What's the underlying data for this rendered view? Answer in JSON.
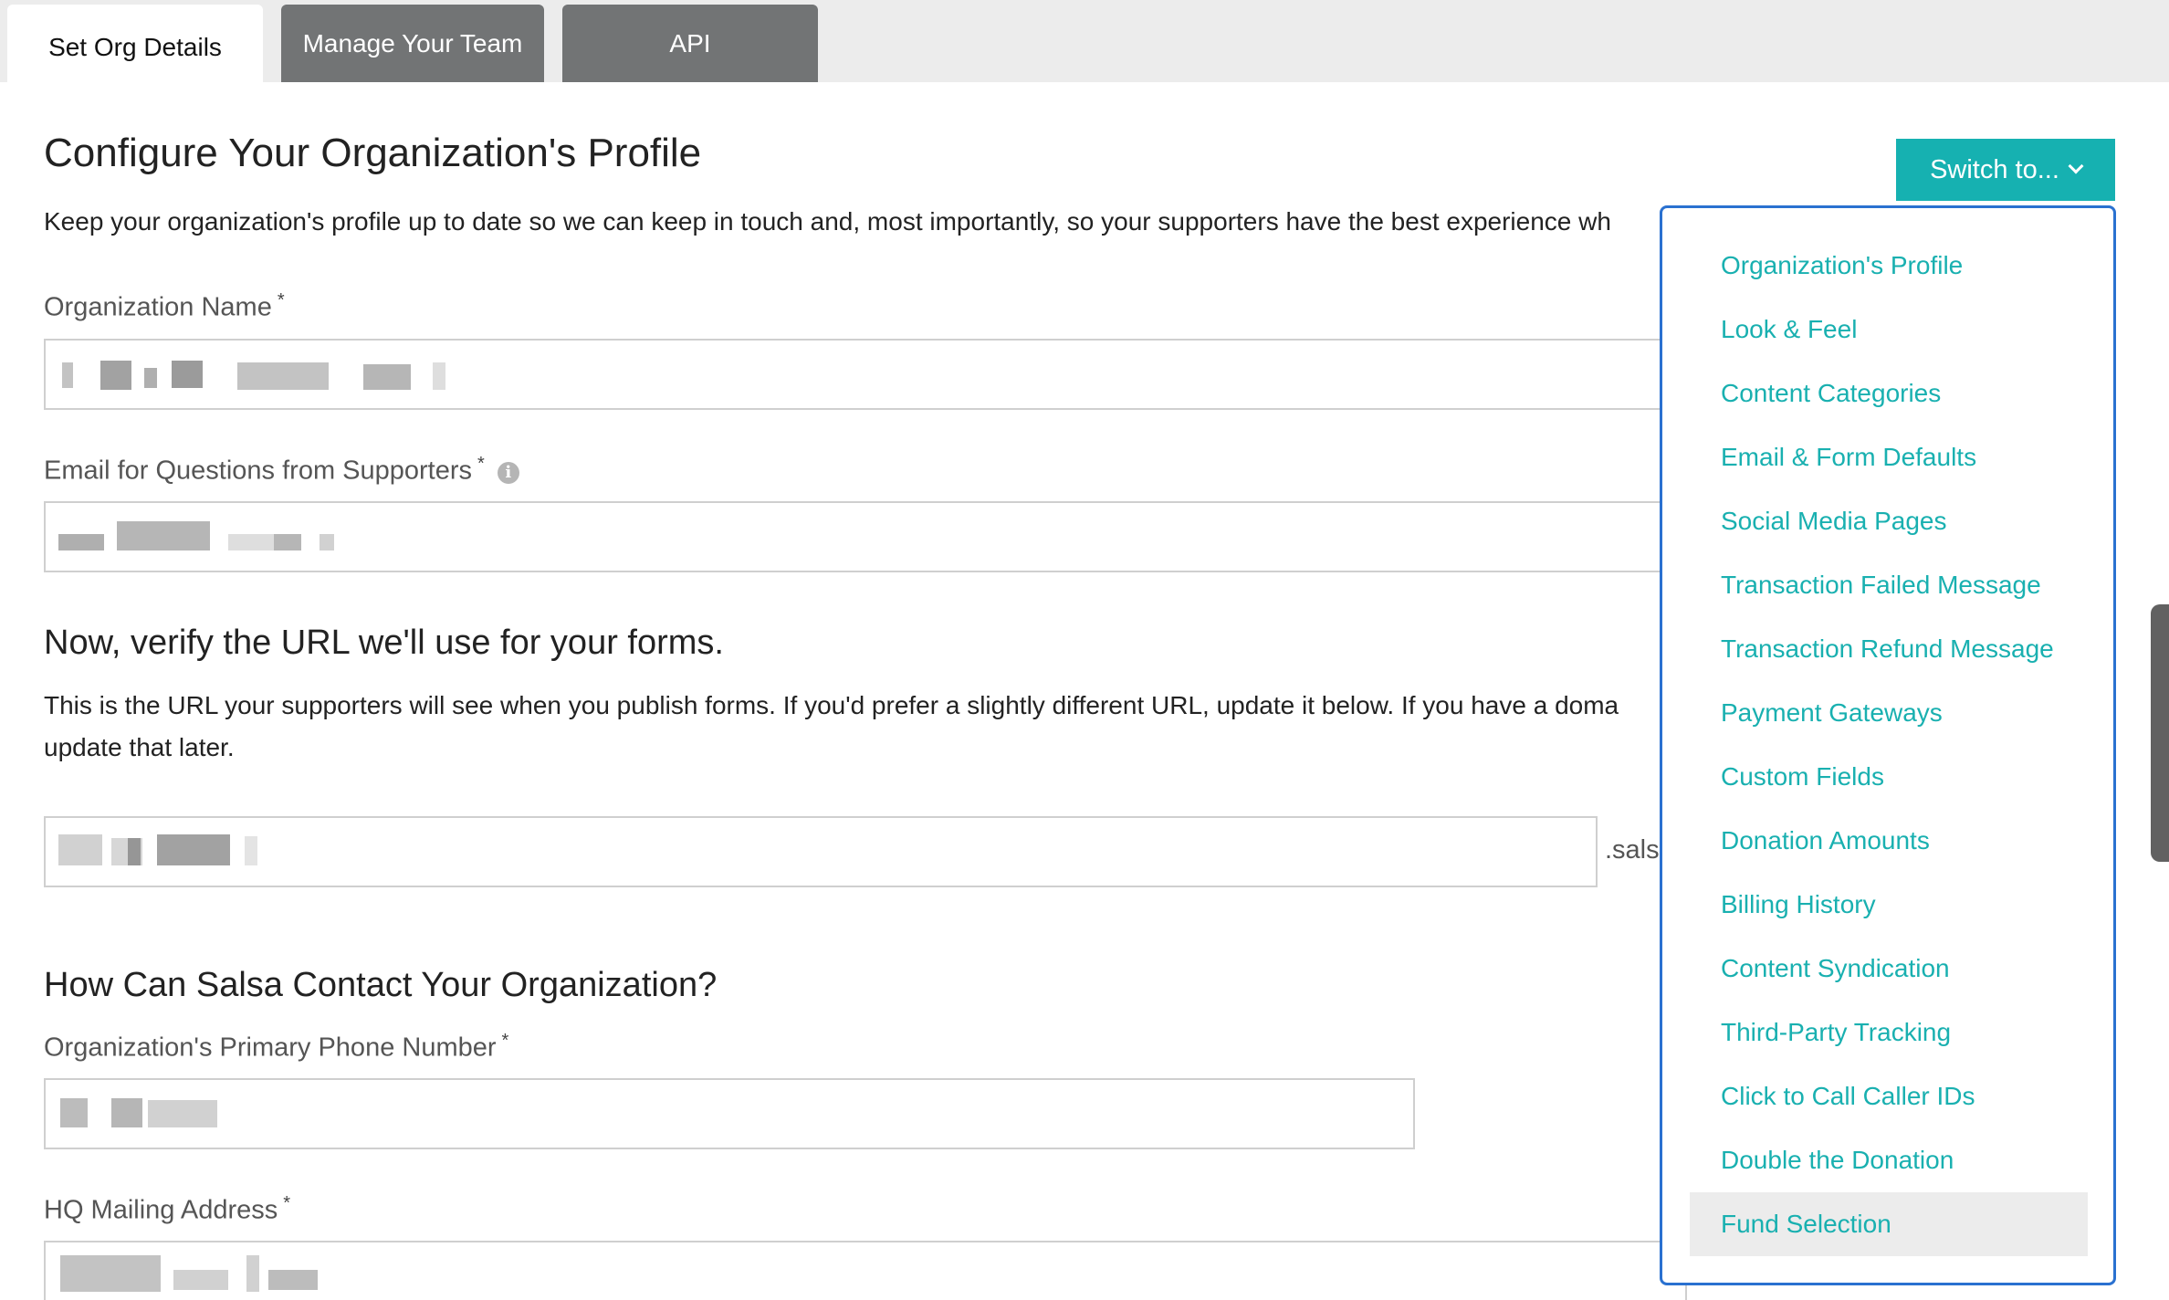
{
  "tabs": [
    {
      "label": "Set Org Details"
    },
    {
      "label": "Manage Your Team"
    },
    {
      "label": "API"
    }
  ],
  "profile": {
    "title": "Configure Your Organization's Profile",
    "description": "Keep your organization's profile up to date so we can keep in touch and, most importantly, so your supporters have the best experience wh"
  },
  "fields": {
    "org_name_label": "Organization Name",
    "email_label": "Email for Questions from Supporters",
    "required_mark": "*",
    "info_glyph": "i"
  },
  "url_section": {
    "title": "Now, verify the URL we'll use for your forms.",
    "line1": "This is the URL your supporters will see when you publish forms. If you'd prefer a slightly different URL, update it below. If you have a doma",
    "line2": "update that later.",
    "suffix": ".sals"
  },
  "contact_section": {
    "title": "How Can Salsa Contact Your Organization?",
    "phone_label": "Organization's Primary Phone Number",
    "address_label": "HQ Mailing Address"
  },
  "switch_button": {
    "label": "Switch to..."
  },
  "dropdown_items": [
    {
      "label": "Organization's Profile"
    },
    {
      "label": "Look & Feel"
    },
    {
      "label": "Content Categories"
    },
    {
      "label": "Email & Form Defaults"
    },
    {
      "label": "Social Media Pages"
    },
    {
      "label": "Transaction Failed Message"
    },
    {
      "label": "Transaction Refund Message"
    },
    {
      "label": "Payment Gateways"
    },
    {
      "label": "Custom Fields"
    },
    {
      "label": "Donation Amounts"
    },
    {
      "label": "Billing History"
    },
    {
      "label": "Content Syndication"
    },
    {
      "label": "Third-Party Tracking"
    },
    {
      "label": "Click to Call Caller IDs"
    },
    {
      "label": "Double the Donation"
    },
    {
      "label": "Fund Selection"
    }
  ],
  "hovered_item": "Fund Selection",
  "colors": {
    "accent": "#16b1b1",
    "dropdown_border": "#2a71d0",
    "inactive_tab": "#727475"
  },
  "icons": [
    "chevron-down-icon",
    "info-icon"
  ]
}
